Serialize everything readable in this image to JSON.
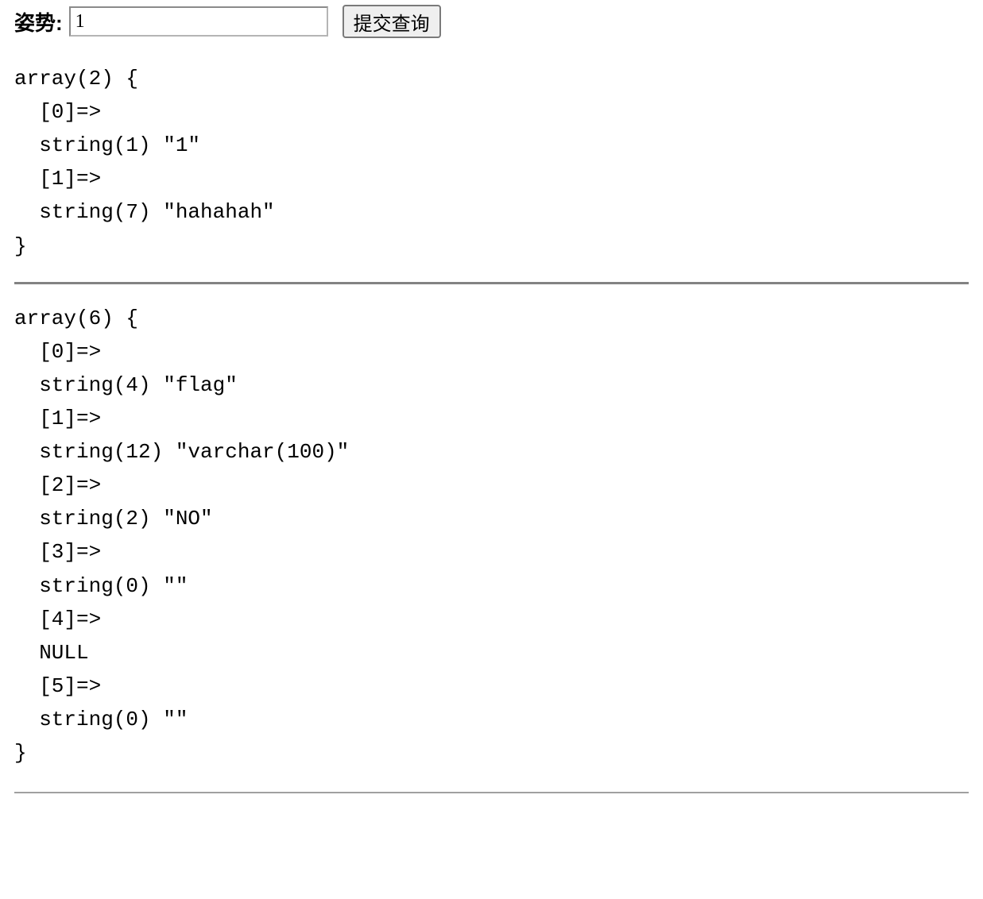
{
  "form": {
    "label": "姿势:",
    "input_value": "1",
    "submit_label": "提交查询"
  },
  "dump1": "array(2) {\n  [0]=>\n  string(1) \"1\"\n  [1]=>\n  string(7) \"hahahah\"\n}",
  "dump2": "array(6) {\n  [0]=>\n  string(4) \"flag\"\n  [1]=>\n  string(12) \"varchar(100)\"\n  [2]=>\n  string(2) \"NO\"\n  [3]=>\n  string(0) \"\"\n  [4]=>\n  NULL\n  [5]=>\n  string(0) \"\"\n}"
}
